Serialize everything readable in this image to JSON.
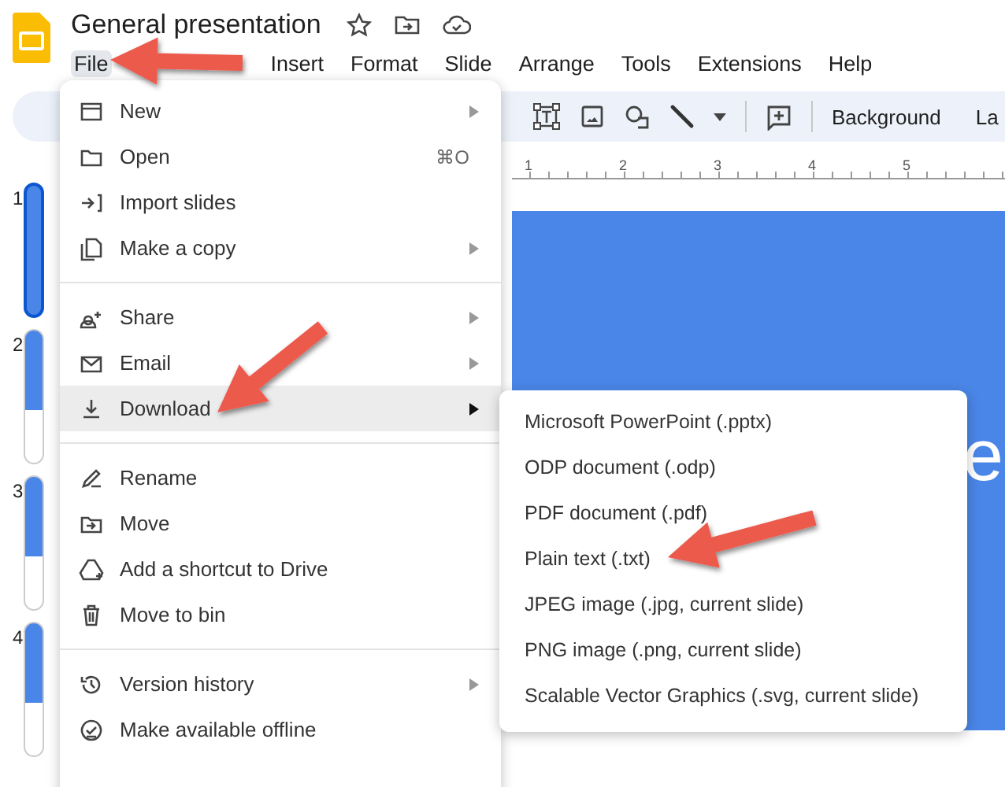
{
  "app": {
    "title": "General presentation"
  },
  "menu_bar": [
    {
      "label": "File",
      "selected": true
    },
    {
      "label": "Insert",
      "selected": false
    },
    {
      "label": "Format",
      "selected": false
    },
    {
      "label": "Slide",
      "selected": false
    },
    {
      "label": "Arrange",
      "selected": false
    },
    {
      "label": "Tools",
      "selected": false
    },
    {
      "label": "Extensions",
      "selected": false
    },
    {
      "label": "Help",
      "selected": false
    }
  ],
  "toolbar": {
    "buttons": [
      "Background",
      "La"
    ]
  },
  "ruler": [
    "1",
    "2",
    "3",
    "4",
    "5"
  ],
  "filmstrip": [
    {
      "number": "1",
      "selected": true
    },
    {
      "number": "2",
      "selected": false
    },
    {
      "number": "3",
      "selected": false
    },
    {
      "number": "4",
      "selected": false
    }
  ],
  "slide": {
    "text": "e"
  },
  "file_menu": {
    "sections": [
      [
        {
          "label": "New",
          "has_submenu": true,
          "highlighted": false
        },
        {
          "label": "Open",
          "shortcut": "⌘O",
          "has_submenu": false,
          "highlighted": false
        },
        {
          "label": "Import slides",
          "has_submenu": false,
          "highlighted": false
        },
        {
          "label": "Make a copy",
          "has_submenu": true,
          "highlighted": false
        }
      ],
      [
        {
          "label": "Share",
          "has_submenu": true,
          "highlighted": false
        },
        {
          "label": "Email",
          "has_submenu": true,
          "highlighted": false
        },
        {
          "label": "Download",
          "has_submenu": true,
          "highlighted": true
        }
      ],
      [
        {
          "label": "Rename",
          "has_submenu": false,
          "highlighted": false
        },
        {
          "label": "Move",
          "has_submenu": false,
          "highlighted": false
        },
        {
          "label": "Add a shortcut to Drive",
          "has_submenu": false,
          "highlighted": false
        },
        {
          "label": "Move to bin",
          "has_submenu": false,
          "highlighted": false
        }
      ],
      [
        {
          "label": "Version history",
          "has_submenu": true,
          "highlighted": false
        },
        {
          "label": "Make available offline",
          "has_submenu": false,
          "highlighted": false
        }
      ]
    ]
  },
  "download_menu": {
    "items": [
      "Microsoft PowerPoint (.pptx)",
      "ODP document (.odp)",
      "PDF document (.pdf)",
      "Plain text (.txt)",
      "JPEG image (.jpg, current slide)",
      "PNG image (.png, current slide)",
      "Scalable Vector Graphics (.svg, current slide)"
    ]
  }
}
